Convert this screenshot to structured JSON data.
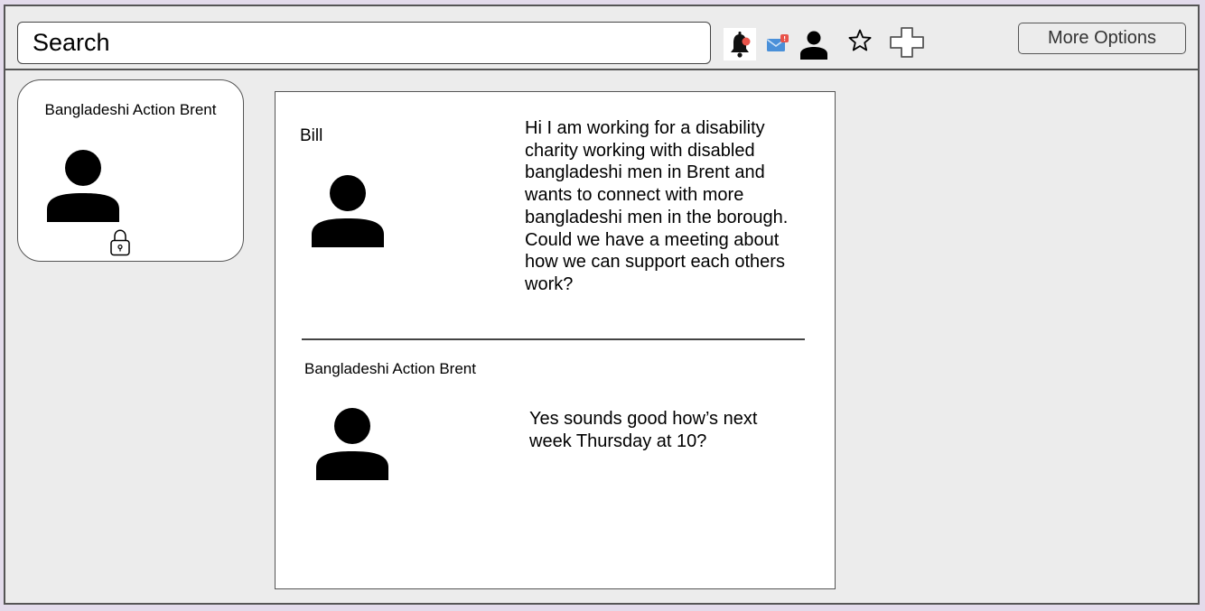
{
  "search": {
    "placeholder": "Search"
  },
  "toolbar": {
    "icons": [
      "bell-icon",
      "mail-icon",
      "user-icon",
      "star-icon",
      "plus-icon"
    ],
    "more_options_label": "More Options"
  },
  "group_card": {
    "name": "Bangladeshi Action Brent",
    "icons": [
      "user-icon",
      "lock-icon"
    ]
  },
  "thread": {
    "messages": [
      {
        "sender": "Bill",
        "text": "Hi I am working for a disability charity working with disabled bangladeshi men in Brent and wants to connect with more bangladeshi men in the borough. Could we have a meeting about how we can support each others work?"
      },
      {
        "sender": "Bangladeshi Action Brent",
        "text": "Yes sounds good how’s next week Thursday at 10?"
      }
    ]
  },
  "colors": {
    "page_background": "#e3dbeb",
    "panel_background": "#ececec",
    "notification_badge": "#e8534a",
    "mail_blue": "#4a90d9"
  }
}
